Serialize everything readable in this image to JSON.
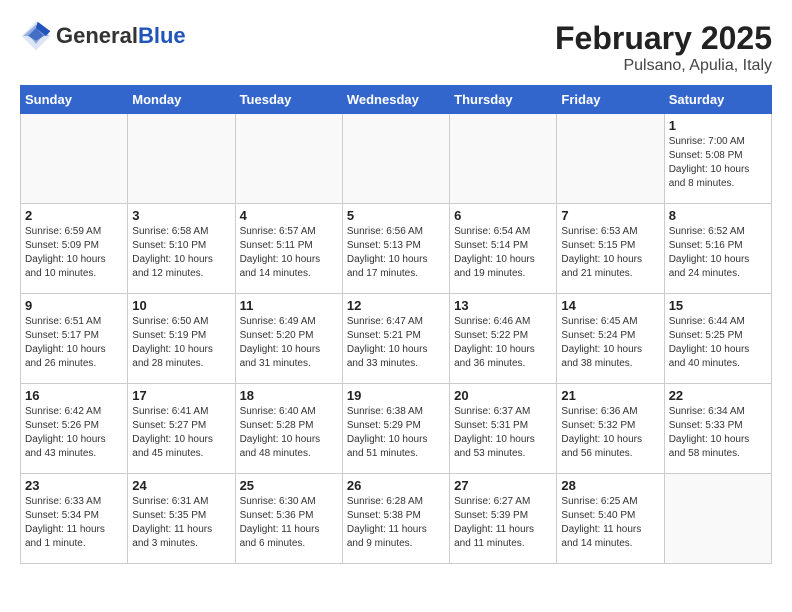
{
  "header": {
    "logo_general": "General",
    "logo_blue": "Blue",
    "month_year": "February 2025",
    "location": "Pulsano, Apulia, Italy"
  },
  "days_of_week": [
    "Sunday",
    "Monday",
    "Tuesday",
    "Wednesday",
    "Thursday",
    "Friday",
    "Saturday"
  ],
  "weeks": [
    [
      {
        "day": "",
        "info": ""
      },
      {
        "day": "",
        "info": ""
      },
      {
        "day": "",
        "info": ""
      },
      {
        "day": "",
        "info": ""
      },
      {
        "day": "",
        "info": ""
      },
      {
        "day": "",
        "info": ""
      },
      {
        "day": "1",
        "info": "Sunrise: 7:00 AM\nSunset: 5:08 PM\nDaylight: 10 hours\nand 8 minutes."
      }
    ],
    [
      {
        "day": "2",
        "info": "Sunrise: 6:59 AM\nSunset: 5:09 PM\nDaylight: 10 hours\nand 10 minutes."
      },
      {
        "day": "3",
        "info": "Sunrise: 6:58 AM\nSunset: 5:10 PM\nDaylight: 10 hours\nand 12 minutes."
      },
      {
        "day": "4",
        "info": "Sunrise: 6:57 AM\nSunset: 5:11 PM\nDaylight: 10 hours\nand 14 minutes."
      },
      {
        "day": "5",
        "info": "Sunrise: 6:56 AM\nSunset: 5:13 PM\nDaylight: 10 hours\nand 17 minutes."
      },
      {
        "day": "6",
        "info": "Sunrise: 6:54 AM\nSunset: 5:14 PM\nDaylight: 10 hours\nand 19 minutes."
      },
      {
        "day": "7",
        "info": "Sunrise: 6:53 AM\nSunset: 5:15 PM\nDaylight: 10 hours\nand 21 minutes."
      },
      {
        "day": "8",
        "info": "Sunrise: 6:52 AM\nSunset: 5:16 PM\nDaylight: 10 hours\nand 24 minutes."
      }
    ],
    [
      {
        "day": "9",
        "info": "Sunrise: 6:51 AM\nSunset: 5:17 PM\nDaylight: 10 hours\nand 26 minutes."
      },
      {
        "day": "10",
        "info": "Sunrise: 6:50 AM\nSunset: 5:19 PM\nDaylight: 10 hours\nand 28 minutes."
      },
      {
        "day": "11",
        "info": "Sunrise: 6:49 AM\nSunset: 5:20 PM\nDaylight: 10 hours\nand 31 minutes."
      },
      {
        "day": "12",
        "info": "Sunrise: 6:47 AM\nSunset: 5:21 PM\nDaylight: 10 hours\nand 33 minutes."
      },
      {
        "day": "13",
        "info": "Sunrise: 6:46 AM\nSunset: 5:22 PM\nDaylight: 10 hours\nand 36 minutes."
      },
      {
        "day": "14",
        "info": "Sunrise: 6:45 AM\nSunset: 5:24 PM\nDaylight: 10 hours\nand 38 minutes."
      },
      {
        "day": "15",
        "info": "Sunrise: 6:44 AM\nSunset: 5:25 PM\nDaylight: 10 hours\nand 40 minutes."
      }
    ],
    [
      {
        "day": "16",
        "info": "Sunrise: 6:42 AM\nSunset: 5:26 PM\nDaylight: 10 hours\nand 43 minutes."
      },
      {
        "day": "17",
        "info": "Sunrise: 6:41 AM\nSunset: 5:27 PM\nDaylight: 10 hours\nand 45 minutes."
      },
      {
        "day": "18",
        "info": "Sunrise: 6:40 AM\nSunset: 5:28 PM\nDaylight: 10 hours\nand 48 minutes."
      },
      {
        "day": "19",
        "info": "Sunrise: 6:38 AM\nSunset: 5:29 PM\nDaylight: 10 hours\nand 51 minutes."
      },
      {
        "day": "20",
        "info": "Sunrise: 6:37 AM\nSunset: 5:31 PM\nDaylight: 10 hours\nand 53 minutes."
      },
      {
        "day": "21",
        "info": "Sunrise: 6:36 AM\nSunset: 5:32 PM\nDaylight: 10 hours\nand 56 minutes."
      },
      {
        "day": "22",
        "info": "Sunrise: 6:34 AM\nSunset: 5:33 PM\nDaylight: 10 hours\nand 58 minutes."
      }
    ],
    [
      {
        "day": "23",
        "info": "Sunrise: 6:33 AM\nSunset: 5:34 PM\nDaylight: 11 hours\nand 1 minute."
      },
      {
        "day": "24",
        "info": "Sunrise: 6:31 AM\nSunset: 5:35 PM\nDaylight: 11 hours\nand 3 minutes."
      },
      {
        "day": "25",
        "info": "Sunrise: 6:30 AM\nSunset: 5:36 PM\nDaylight: 11 hours\nand 6 minutes."
      },
      {
        "day": "26",
        "info": "Sunrise: 6:28 AM\nSunset: 5:38 PM\nDaylight: 11 hours\nand 9 minutes."
      },
      {
        "day": "27",
        "info": "Sunrise: 6:27 AM\nSunset: 5:39 PM\nDaylight: 11 hours\nand 11 minutes."
      },
      {
        "day": "28",
        "info": "Sunrise: 6:25 AM\nSunset: 5:40 PM\nDaylight: 11 hours\nand 14 minutes."
      },
      {
        "day": "",
        "info": ""
      }
    ]
  ]
}
